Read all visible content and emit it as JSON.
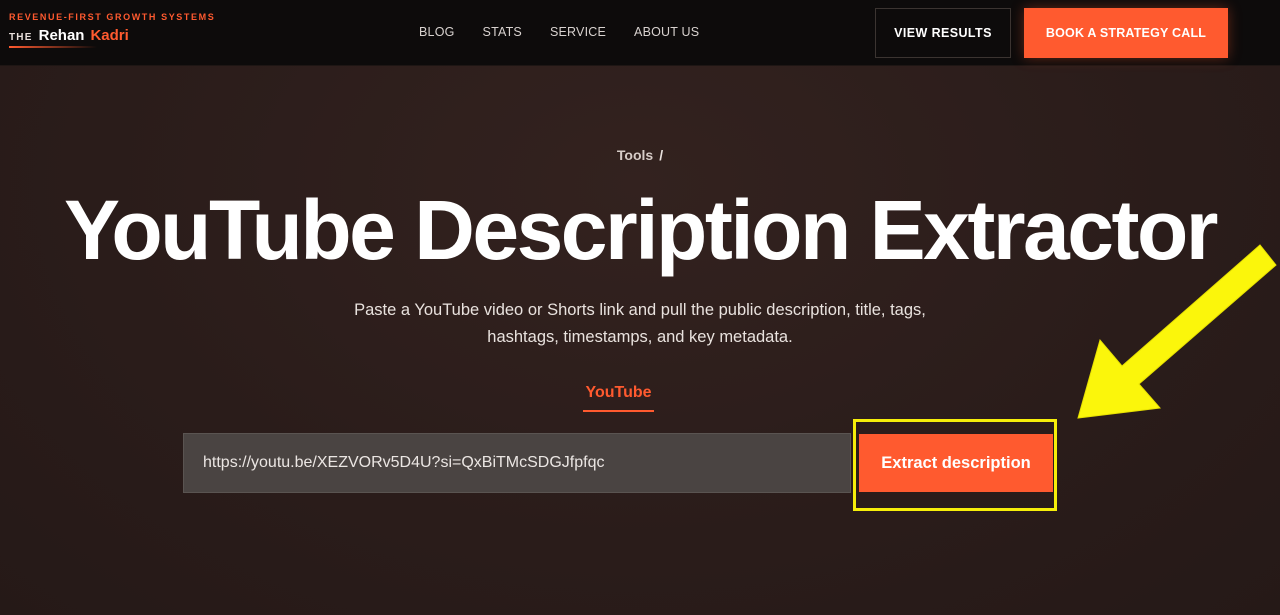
{
  "header": {
    "brand_tagline": "REVENUE-FIRST GROWTH SYSTEMS",
    "brand_the": "THE",
    "brand_name_first": "Rehan",
    "brand_name_last": "Kadri",
    "nav": [
      "BLOG",
      "STATS",
      "SERVICE",
      "ABOUT US"
    ],
    "view_results_label": "VIEW RESULTS",
    "book_call_label": "BOOK A STRATEGY CALL"
  },
  "hero": {
    "breadcrumb": "Tools",
    "breadcrumb_sep": "/",
    "title": "YouTube Description Extractor",
    "subtitle": "Paste a YouTube video or Shorts link and pull the public description, title, tags, hashtags, timestamps, and key metadata."
  },
  "extractor": {
    "tab_label": "YouTube",
    "url_value": "https://youtu.be/XEZVORv5D4U?si=QxBiTMcSDGJfpfqc",
    "button_label": "Extract description"
  },
  "colors": {
    "accent": "#ff5a2f",
    "highlight": "#f6ee0a",
    "header_bg": "#0d0b0b",
    "page_bg": "#2b1d1b"
  },
  "icons": {
    "annotation": "arrow-pointer-icon"
  }
}
